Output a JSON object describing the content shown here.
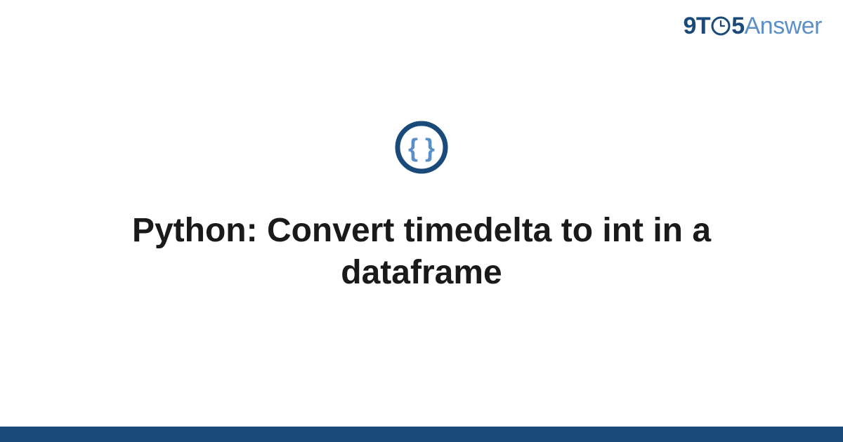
{
  "brand": {
    "prefix": "9T",
    "between": "5",
    "suffix": "Answer"
  },
  "page": {
    "title": "Python: Convert timedelta to int in a dataframe"
  },
  "colors": {
    "brand_dark": "#1a4a7a",
    "brand_light": "#5b8fc7"
  }
}
